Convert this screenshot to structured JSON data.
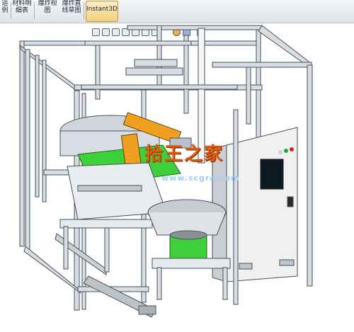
{
  "toolbar": {
    "anim_label_1": "运",
    "anim_label_2": "例",
    "bom_label_1": "材料明",
    "bom_label_2": "细表",
    "explode_label_1": "爆炸视",
    "explode_label_2": "图",
    "line_label_1": "爆炸直",
    "line_label_2": "线草图",
    "instant3d_label": "Instant3D"
  },
  "watermark": {
    "title": "拾王之家",
    "url": "www.scgra.com"
  },
  "colors": {
    "frame": "#d7dde3",
    "frame_edge": "#4a5158",
    "robot": "#f0a020",
    "green_part": "#3fcf3a",
    "panel": "#f0f0f0"
  }
}
